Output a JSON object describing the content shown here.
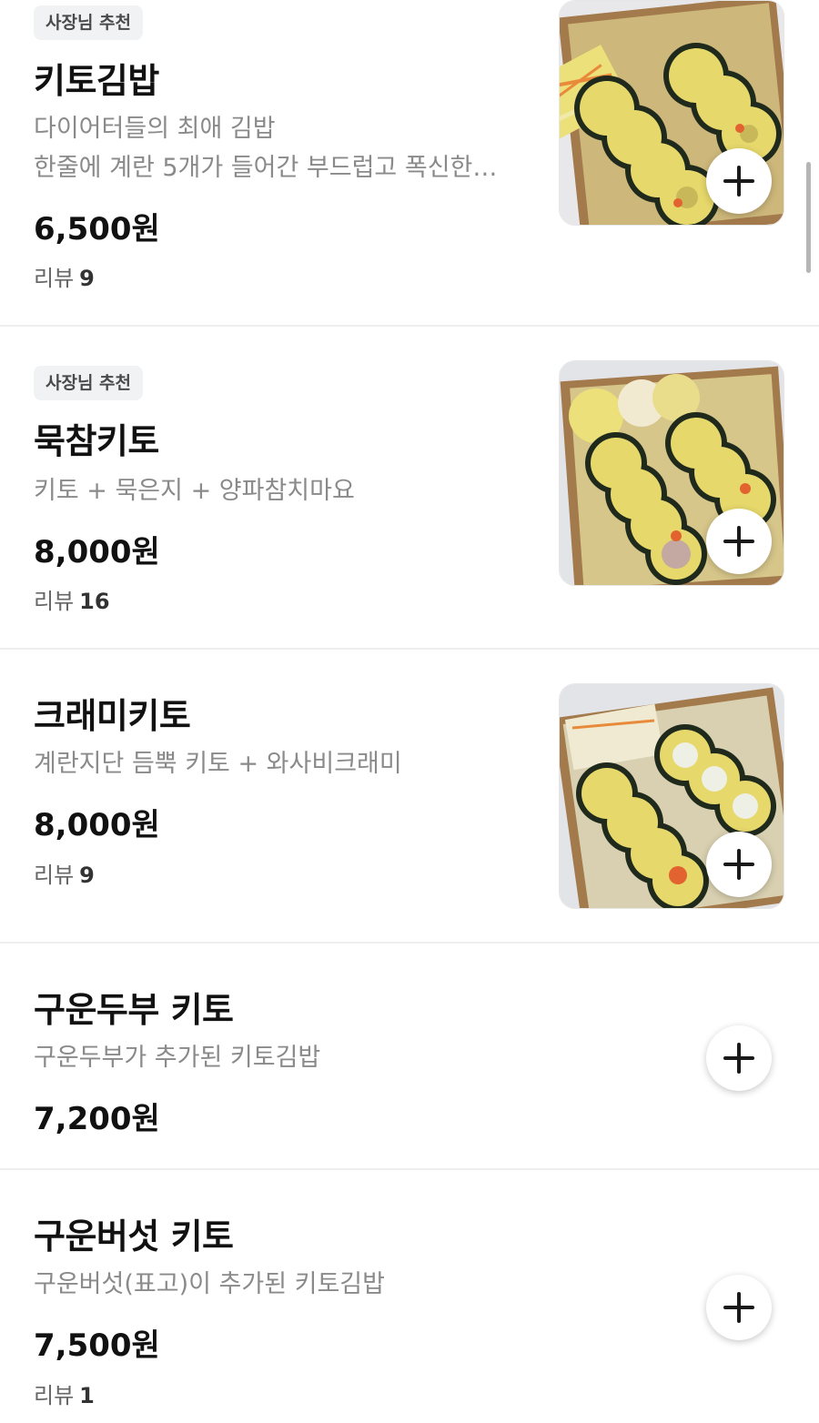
{
  "menu": {
    "items": [
      {
        "badge": "사장님 추천",
        "name": "키토김밥",
        "desc_line1": "다이어터들의 최애 김밥",
        "desc_line2": "한줄에 계란 5개가 들어간 부드럽고 폭신한…",
        "price": "6,500원",
        "review_label": "리뷰",
        "review_count": "9"
      },
      {
        "badge": "사장님 추천",
        "name": "묵참키토",
        "desc_line1": "키토 + 묵은지 + 양파참치마요",
        "price": "8,000원",
        "review_label": "리뷰",
        "review_count": "16"
      },
      {
        "name": "크래미키토",
        "desc_line1": "계란지단 듬뿍 키토 + 와사비크래미",
        "price": "8,000원",
        "review_label": "리뷰",
        "review_count": "9"
      },
      {
        "name": "구운두부 키토",
        "desc_line1": "구운두부가 추가된 키토김밥",
        "price": "7,200원"
      },
      {
        "name": "구운버섯 키토",
        "desc_line1": "구운버섯(표고)이 추가된 키토김밥",
        "price": "7,500원",
        "review_label": "리뷰",
        "review_count": "1"
      }
    ]
  },
  "icons": {
    "add": "plus-icon",
    "photo": "kimbap-photo"
  },
  "colors": {
    "badge_bg": "#f1f2f4",
    "desc_text": "#8a8a8a",
    "divider": "#eeeeee",
    "egg_yellow": "#e6d86a",
    "seaweed": "#1f2a1c"
  }
}
